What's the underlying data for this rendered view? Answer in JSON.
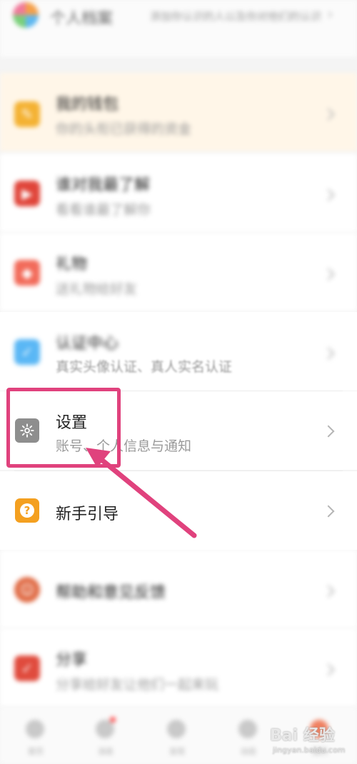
{
  "header": {
    "title": "个人档案",
    "subtitle": "添加你认识的人以及你对他们的认识",
    "chevron": "›"
  },
  "items": [
    {
      "name": "my-wallet",
      "title": "我的钱包",
      "subtitle": "你的头衔已获得的资金",
      "icon": "wallet-icon",
      "color": "#f4b233",
      "blur": true
    },
    {
      "name": "who-knows-me",
      "title": "谁对我最了解",
      "subtitle": "看看谁最了解你",
      "icon": "video-icon",
      "color": "#e0453a",
      "blur": true
    },
    {
      "name": "gift",
      "title": "礼物",
      "subtitle": "送礼物给好友",
      "icon": "gift-icon",
      "color": "#f26b5a",
      "blur": true
    },
    {
      "name": "verification-center",
      "title": "认证中心",
      "subtitle": "真实头像认证、真人实名认证",
      "icon": "check-icon",
      "color": "#5ab7f5",
      "blur": true
    },
    {
      "name": "settings",
      "title": "设置",
      "subtitle": "账号、个人信息与通知",
      "icon": "gear-icon",
      "color": "#8e8e8e",
      "blur": false
    },
    {
      "name": "beginner-guide",
      "title": "新手引导",
      "subtitle": "",
      "icon": "question-icon",
      "color": "#f4a020",
      "blur": false
    },
    {
      "name": "help-feedback",
      "title": "帮助和意见反馈",
      "subtitle": "",
      "icon": "help-icon",
      "color": "#e06b45",
      "blur": true
    },
    {
      "name": "share",
      "title": "分享",
      "subtitle": "分享给好友让他们一起来玩",
      "icon": "share-icon",
      "color": "#e04b3d",
      "blur": true
    }
  ],
  "tabs": [
    {
      "label": "首页"
    },
    {
      "label": "消息",
      "badge": true
    },
    {
      "label": "发现"
    },
    {
      "label": "动态"
    },
    {
      "label": "我的"
    }
  ],
  "watermark": {
    "main": "Bai 经验",
    "sub": "jingyan.baidu.com"
  },
  "annotation": {
    "color": "#e0427d"
  }
}
